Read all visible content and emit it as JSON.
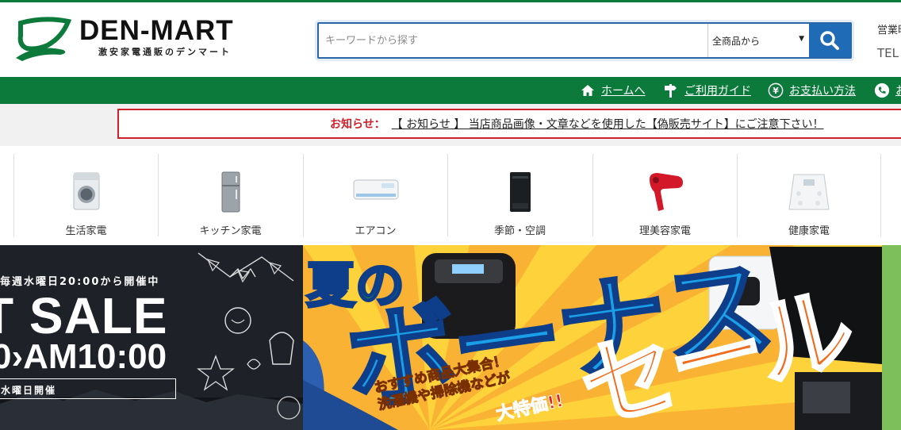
{
  "header": {
    "logo_name": "DEN-MART",
    "logo_tagline": "激安家電通販のデンマート",
    "search_placeholder": "キーワードから探す",
    "search_category": "全商品から",
    "business_hours_label": "営業時",
    "tel_label": "TEL"
  },
  "nav": {
    "items": [
      {
        "label": "ホームへ",
        "icon": "home-icon"
      },
      {
        "label": "ご利用ガイド",
        "icon": "signpost-icon"
      },
      {
        "label": "お支払い方法",
        "icon": "yen-icon"
      },
      {
        "label": "お",
        "icon": "phone-icon"
      }
    ]
  },
  "notice": {
    "label": "お知らせ：",
    "text": "【 お知らせ 】 当店商品画像・文章などを使用した【偽販売サイト】にご注意下さい！"
  },
  "categories": [
    {
      "label": "生活家電",
      "icon": "washing-machine-icon"
    },
    {
      "label": "キッチン家電",
      "icon": "refrigerator-icon"
    },
    {
      "label": "エアコン",
      "icon": "air-conditioner-icon"
    },
    {
      "label": "季節・空調",
      "icon": "air-purifier-icon"
    },
    {
      "label": "理美容家電",
      "icon": "hair-dryer-icon"
    },
    {
      "label": "健康家電",
      "icon": "body-scale-icon"
    }
  ],
  "banner_left": {
    "line1": "毎週水曜日20:00から開催中",
    "line2": "T SALE",
    "line3": "0›AM10:00",
    "line4": "水曜日開催"
  },
  "banner_main": {
    "title_1": "夏の",
    "title_2": "ボーナス",
    "title_3": "セール",
    "sub_1": "おすすめ商品大集合！",
    "sub_2": "洗濯機や掃除機などが",
    "price": "大特価!!"
  },
  "colors": {
    "brand_green": "#0b7a3a",
    "search_blue": "#1f6bb5",
    "notice_red": "#d0202b"
  }
}
